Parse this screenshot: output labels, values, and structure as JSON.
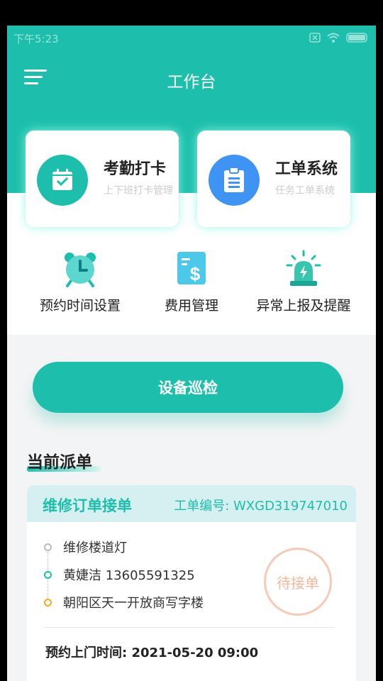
{
  "statusbar": {
    "time": "下午5:23"
  },
  "navbar": {
    "title": "工作台"
  },
  "cards": [
    {
      "title": "考勤打卡",
      "subtitle": "上下班打卡管理",
      "icon": "calendar-check-icon"
    },
    {
      "title": "工单系统",
      "subtitle": "任务工单系统",
      "icon": "clipboard-icon"
    }
  ],
  "features": [
    {
      "label": "预约时间设置",
      "icon": "alarm-clock-icon"
    },
    {
      "label": "费用管理",
      "icon": "bill-dollar-icon"
    },
    {
      "label": "异常上报及提醒",
      "icon": "siren-icon"
    }
  ],
  "patrol_button": "设备巡检",
  "section": {
    "title": "当前派单"
  },
  "order": {
    "type": "维修订单接单",
    "number": "工单编号: WXGD319747010",
    "item": "维修楼道灯",
    "contact": "黄婕洁 13605591325",
    "address": "朝阳区天一开放商写字楼",
    "status": "待接单",
    "appointment": "预约上门时间: 2021-05-20 09:00"
  },
  "colors": {
    "primary": "#1dbfac",
    "blue": "#3f93f2",
    "status": "#f4b79c"
  }
}
